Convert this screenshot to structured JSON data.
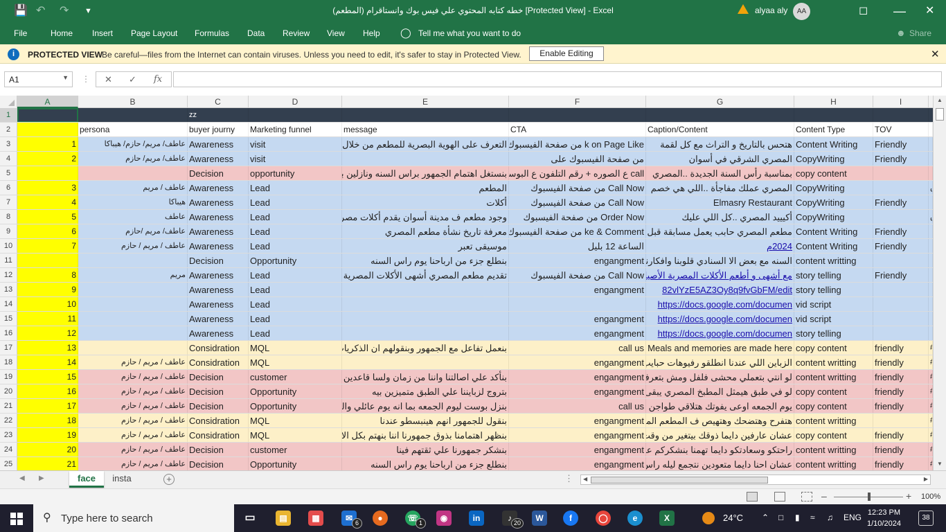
{
  "window": {
    "title": "خطه كتابه المحتوي علي فيس بوك وانستاقرام (المطعم)  [Protected View]  -  Excel",
    "user": "alyaa aly",
    "avatar": "AA"
  },
  "menu": {
    "file": "File",
    "home": "Home",
    "insert": "Insert",
    "page_layout": "Page Layout",
    "formulas": "Formulas",
    "data": "Data",
    "review": "Review",
    "view": "View",
    "help": "Help",
    "tell_me": "Tell me what you want to do",
    "share": "Share"
  },
  "protected": {
    "title": "PROTECTED VIEW",
    "message": "Be careful—files from the Internet can contain viruses. Unless you need to edit, it's safer to stay in Protected View.",
    "button": "Enable Editing"
  },
  "formula": {
    "namebox": "A1",
    "fx": "fx",
    "content": ""
  },
  "columns": [
    "A",
    "B",
    "C",
    "D",
    "E",
    "F",
    "G",
    "H",
    "I"
  ],
  "rows": [
    {
      "n": "1",
      "bg": "#333f4f",
      "cells": [
        "",
        "",
        "zz",
        "",
        "",
        "",
        "",
        "",
        "",
        ""
      ]
    },
    {
      "n": "2",
      "bg": "#ffffff",
      "cells": [
        "",
        "persona",
        "buyer journy",
        "Marketing funnel",
        "message",
        "CTA",
        "Caption/Content",
        "Content Type",
        "TOV",
        ""
      ]
    },
    {
      "n": "3",
      "bg": "#c5d9f1",
      "cells": [
        "1",
        "عاطف/ مريم/ حازم/ هيباكا",
        "Awareness",
        "visit",
        "التعرف على الهوية البصرية للمطعم من خلال اللو",
        "k on Page Like من صفحة الفيسبوك",
        "هتحس بالتاريخ و التراث مع كل لقمة",
        "Content Writing",
        "Friendly",
        ""
      ]
    },
    {
      "n": "4",
      "bg": "#c5d9f1",
      "cells": [
        "2",
        "عاطف/ مريم/ حازم",
        "Awareness",
        "visit",
        "",
        "من صفحة الفيسبوك على",
        "المصري الشرقي في أسوان",
        "CopyWriting",
        "Friendly",
        ""
      ]
    },
    {
      "n": "5",
      "bg": "#f2c6c6",
      "cells": [
        "",
        "",
        "Decision",
        "opportunity",
        "بنستغل اهتمام الجمهور براس السنه ونازلين بعروض",
        "call ع الصوره + رقم التلفون ع البوست",
        "بمناسبة رأس السنة الجديدة ..المصري",
        "copy content",
        "",
        ""
      ]
    },
    {
      "n": "6",
      "bg": "#c5d9f1",
      "cells": [
        "3",
        "عاطف / مريم",
        "Awareness",
        "Lead",
        "المطعم",
        "Call Now من صفحة الفيسبوك",
        "المصري عملك مفاجأة ..اللي هي خصم",
        "CopyWriting",
        "",
        "متحمس"
      ]
    },
    {
      "n": "7",
      "bg": "#c5d9f1",
      "cells": [
        "4",
        "هيباكا",
        "Awareness",
        "Lead",
        "أكلات",
        "Call Now من صفحة الفيسبوك",
        "Elmasry Restaurant",
        "CopyWriting",
        "Friendly",
        ""
      ]
    },
    {
      "n": "8",
      "bg": "#c5d9f1",
      "cells": [
        "5",
        "عاطف",
        "Awareness",
        "Lead",
        "وجود مطعم ف مدينة أسوان يقدم أكلات مصرية أ",
        "Order Now من صفحة الفيسبوك",
        "أكيييد المصري ..كل اللي عليك",
        "CopyWriting",
        "",
        "متحمس"
      ]
    },
    {
      "n": "9",
      "bg": "#c5d9f1",
      "cells": [
        "6",
        "عاطف/ مريم /حازم",
        "Awareness",
        "Lead",
        "معرفة تاريخ نشأة مطعم المصري",
        "ke & Comment من صفحة الفيسبوك",
        "مطعم المصري حابب يعمل مسابقة قبل ما",
        "Content Writing",
        "Friendly",
        ""
      ]
    },
    {
      "n": "10",
      "bg": "#c5d9f1",
      "cells": [
        "7",
        "عاطف / مريم / حازم",
        "Awareness",
        "Lead",
        "موسيقى تعبر",
        "الساعة 12 بليل",
        "2024م",
        "Content Writing",
        "Friendly",
        ""
      ]
    },
    {
      "n": "11",
      "bg": "#c5d9f1",
      "cells": [
        "",
        "",
        "Decision",
        "Opportunity",
        "بنطلع جزء من ارباحنا يوم راس السنه",
        "engangment",
        "السنه مع بعض الا السنادي قلوبنا وافكارنا",
        "content writting",
        "",
        ""
      ]
    },
    {
      "n": "12",
      "bg": "#c5d9f1",
      "cells": [
        "8",
        "مريم",
        "Awareness",
        "Lead",
        "تقديم مطعم المصري أشهى الأكلات المصرية الشر",
        "Call Now من صفحة الفيسبوك",
        "مع أشهى و أطعم الأكلات المصرية الأصيلة",
        "story telling",
        "Friendly",
        ""
      ]
    },
    {
      "n": "13",
      "bg": "#c5d9f1",
      "cells": [
        "9",
        "",
        "Awareness",
        "Lead",
        "",
        "engangment",
        "82vlYzE5AZ3Oy8q9fvGbFM/edit",
        "story telling",
        "",
        ""
      ]
    },
    {
      "n": "14",
      "bg": "#c5d9f1",
      "cells": [
        "10",
        "",
        "Awareness",
        "Lead",
        "",
        "",
        "https://docs.google.com/documen",
        "vid script",
        "",
        ""
      ]
    },
    {
      "n": "15",
      "bg": "#c5d9f1",
      "cells": [
        "11",
        "",
        "Awareness",
        "Lead",
        "",
        "engangment",
        "https://docs.google.com/documen",
        "vid script",
        "",
        ""
      ]
    },
    {
      "n": "16",
      "bg": "#c5d9f1",
      "cells": [
        "12",
        "",
        "Awareness",
        "Lead",
        "",
        "engangment",
        "https://docs.google.com/documen",
        "story telling",
        "",
        ""
      ]
    },
    {
      "n": "17",
      "bg": "#fdf0c8",
      "cells": [
        "13",
        "",
        "Considration",
        "MQL",
        "بنعمل تفاعل مع الجمهور وبنقولهم ان الذكريات ب",
        "call us",
        "Meals and memories are made here",
        "copy content",
        "friendly",
        "#"
      ]
    },
    {
      "n": "18",
      "bg": "#fdf0c8",
      "cells": [
        "14",
        "عاطف / مريم / حازم",
        "Considration",
        "MQL",
        "",
        "engangment",
        "الزباين اللي عندنا انطلقو رفيوهات حبايب ال",
        "content writting",
        "friendly",
        "#"
      ]
    },
    {
      "n": "19",
      "bg": "#f2c6c6",
      "cells": [
        "15",
        "عاطف / مريم / حازم",
        "Decision",
        "customer",
        "بنأكد علي اصالتنا واننا من زمان ولسا قاعدين",
        "engangment",
        "لو انتي بتعملي محشى فلفل ومش بتعرفي تخ",
        "content writting",
        "friendly",
        "#"
      ]
    },
    {
      "n": "20",
      "bg": "#f2c6c6",
      "cells": [
        "16",
        "عاطف / مريم / حازم",
        "Decision",
        "Opportunity",
        "بتروج لزبايننا علي الطبق متميزين بيه",
        "engangment",
        "لو في طبق هيمثل المطبخ المصري يبقى فته ا",
        "copy content",
        "friendly",
        "#"
      ]
    },
    {
      "n": "21",
      "bg": "#f2c6c6",
      "cells": [
        "17",
        "عاطف / مريم / حازم",
        "Decision",
        "Opportunity",
        "بنزل بوست ليوم الجمعه بما انه يوم عائلي والناس",
        "call us",
        "يوم الجمعه اوعى يفوتك هتلاقي طواجن وفته",
        "copy content",
        "friendly",
        "#"
      ]
    },
    {
      "n": "22",
      "bg": "#fdf0c8",
      "cells": [
        "18",
        "عاطف / مريم / حازم",
        "Considration",
        "MQL",
        "بنقول للجمهور انهم هينبسطو عندنا",
        "engangment",
        "هتفرح وهتضحك وهتهيص ف المطعم المص",
        "content writting",
        "",
        "#"
      ]
    },
    {
      "n": "23",
      "bg": "#fdf0c8",
      "cells": [
        "19",
        "عاطف / مريم / حازم",
        "Considration",
        "MQL",
        "بنظهر اهتمامنا بذوق جمهورنا اننا بنهتم بكل الازوا",
        "engangment",
        "عشان عارفين دايما ذوقك بيتغير من وقت لتا",
        "copy content",
        "friendly",
        "#"
      ]
    },
    {
      "n": "24",
      "bg": "#f2c6c6",
      "cells": [
        "20",
        "عاطف / مريم / حازم",
        "Decision",
        "customer",
        "بنشكر جمهورنا علي ثقتهم فينا",
        "engangment",
        "راحتكو وسعادتكو دايما تهمنا بنشكركم على ثقا",
        "content writting",
        "friendly",
        "#"
      ]
    },
    {
      "n": "25",
      "bg": "#f2c6c6",
      "cells": [
        "21",
        "عاطف / مريم / حازم",
        "Decision",
        "Opportunity",
        "بنطلع جزء من ارباحنا يوم راس السنه",
        "engangment",
        "عشان احنا دايما متعودين نتجمع ليله راس السنه",
        "content writting",
        "friendly",
        "#"
      ]
    }
  ],
  "sheets": {
    "active": "face",
    "other": "insta"
  },
  "status": {
    "zoom": "100%"
  },
  "taskbar": {
    "search": "Type here to search",
    "temp": "24°C",
    "lang": "ENG",
    "time": "12:23 PM",
    "date": "1/10/2024",
    "notifications": "38",
    "badges": [
      "6",
      "1",
      "20"
    ]
  },
  "colors": {
    "excel_green": "#217346",
    "header_dark": "#333f4f",
    "blue_row": "#c5d9f1",
    "pink_row": "#f2c6c6",
    "yellow_row": "#fdf0c8",
    "col_a": "#ffff00"
  },
  "icons": [
    "save-icon",
    "undo-icon",
    "redo-icon",
    "warning-icon",
    "minimize-icon",
    "restore-icon",
    "close-icon",
    "lightbulb-icon",
    "info-icon",
    "windows-icon",
    "search-icon",
    "wifi-icon",
    "volume-icon"
  ]
}
